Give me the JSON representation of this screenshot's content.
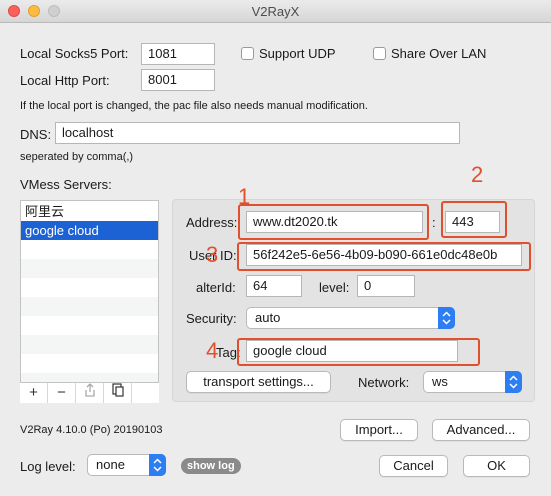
{
  "window": {
    "title": "V2RayX"
  },
  "local": {
    "socks5_label": "Local Socks5 Port:",
    "socks5_value": "1081",
    "http_label": "Local Http Port:",
    "http_value": "8001",
    "support_udp_label": "Support UDP",
    "support_udp_checked": false,
    "share_lan_label": "Share Over LAN",
    "share_lan_checked": false,
    "port_note": "If the local port is changed, the pac file also needs manual modification."
  },
  "dns": {
    "label": "DNS:",
    "value": "localhost",
    "note": "seperated by comma(,)"
  },
  "servers": {
    "label": "VMess Servers:",
    "items": [
      "阿里云",
      "google cloud"
    ],
    "selected_index": 1,
    "tools": {
      "add": "+",
      "remove": "−"
    }
  },
  "server_detail": {
    "address_label": "Address:",
    "address_value": "www.dt2020.tk",
    "colon": ":",
    "port_value": "443",
    "userid_label": "User ID:",
    "userid_value": "56f242e5-6e56-4b09-b090-661e0dc48e0b",
    "alterid_label": "alterId:",
    "alterid_value": "64",
    "level_label": "level:",
    "level_value": "0",
    "security_label": "Security:",
    "security_value": "auto",
    "tag_label": "Tag:",
    "tag_value": "google cloud",
    "transport_button": "transport settings...",
    "network_label": "Network:",
    "network_value": "ws"
  },
  "annotations": {
    "marker_1": "1",
    "marker_2": "2",
    "marker_3": "3",
    "marker_4": "4",
    "color": "#e0502e"
  },
  "footer": {
    "version": "V2Ray 4.10.0 (Po) 20190103",
    "import_button": "Import...",
    "advanced_button": "Advanced...",
    "log_label": "Log level:",
    "log_value": "none",
    "show_log": "show log",
    "cancel_button": "Cancel",
    "ok_button": "OK"
  },
  "colors": {
    "selection": "#1d62d5",
    "popup_accent": "#2d7ef2"
  }
}
